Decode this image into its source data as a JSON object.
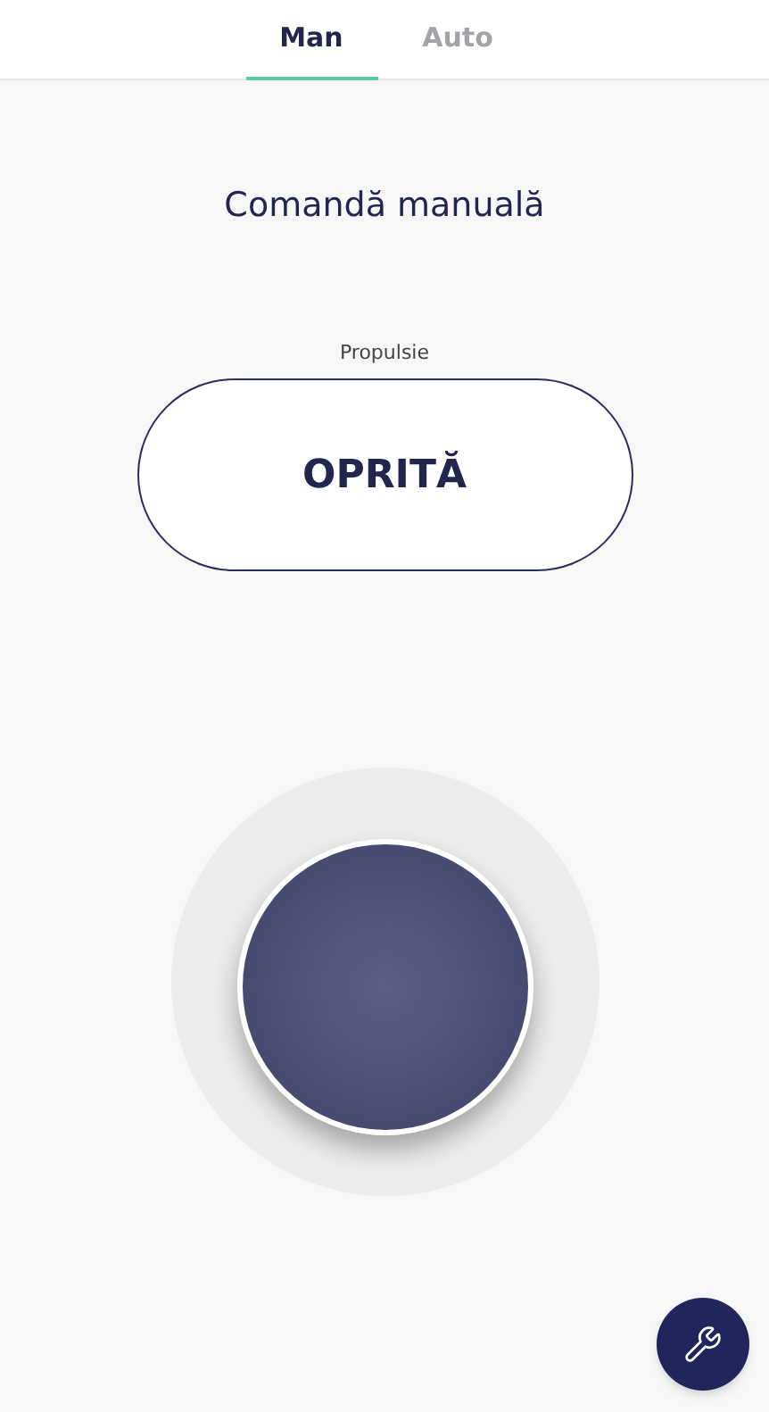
{
  "tabs": [
    {
      "label": "Man",
      "selected": true
    },
    {
      "label": "Auto",
      "selected": false
    }
  ],
  "title": "Comandă manuală",
  "propulsion": {
    "label": "Propulsie",
    "value": "OPRITĂ"
  }
}
